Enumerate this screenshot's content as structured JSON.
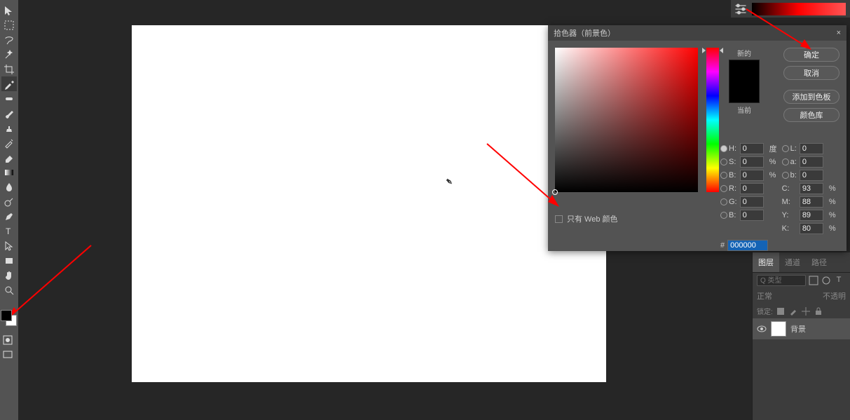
{
  "toolbox": {
    "tools": [
      "move",
      "rect-marquee",
      "lasso",
      "magic-wand",
      "crop",
      "eyedropper",
      "spot-heal",
      "brush",
      "clone",
      "history-brush",
      "eraser",
      "gradient",
      "blur",
      "dodge",
      "pen",
      "type",
      "path-select",
      "rectangle",
      "hand",
      "zoom"
    ],
    "foreground": "#000000",
    "background": "#ffffff",
    "bottom": [
      "quickmask",
      "screenmode"
    ]
  },
  "picker": {
    "title": "拾色器（前景色）",
    "close": "×",
    "new_label": "新的",
    "current_label": "当前",
    "new_color": "#000000",
    "current_color": "#000000",
    "buttons": {
      "ok": "确定",
      "cancel": "取消",
      "add": "添加到色板",
      "lib": "颜色库"
    },
    "web_only": "只有 Web 颜色",
    "fields": {
      "H": {
        "label": "H:",
        "val": "0",
        "unit": "度"
      },
      "S": {
        "label": "S:",
        "val": "0",
        "unit": "%"
      },
      "Bv": {
        "label": "B:",
        "val": "0",
        "unit": "%"
      },
      "L": {
        "label": "L:",
        "val": "0",
        "unit": ""
      },
      "a": {
        "label": "a:",
        "val": "0",
        "unit": ""
      },
      "b": {
        "label": "b:",
        "val": "0",
        "unit": ""
      },
      "R": {
        "label": "R:",
        "val": "0",
        "unit": ""
      },
      "G": {
        "label": "G:",
        "val": "0",
        "unit": ""
      },
      "Bc": {
        "label": "B:",
        "val": "0",
        "unit": ""
      },
      "C": {
        "label": "C:",
        "val": "93",
        "unit": "%"
      },
      "M": {
        "label": "M:",
        "val": "88",
        "unit": "%"
      },
      "Y": {
        "label": "Y:",
        "val": "89",
        "unit": "%"
      },
      "K": {
        "label": "K:",
        "val": "80",
        "unit": "%"
      }
    },
    "hex": {
      "label": "#",
      "val": "000000"
    }
  },
  "rpanel": {
    "tabs": [
      "图层",
      "通道",
      "路径"
    ],
    "search_placeholder": "Q 类型",
    "blend": "正常",
    "opacity_label": "不透明",
    "lock_label": "锁定:",
    "layer_name": "背景"
  }
}
